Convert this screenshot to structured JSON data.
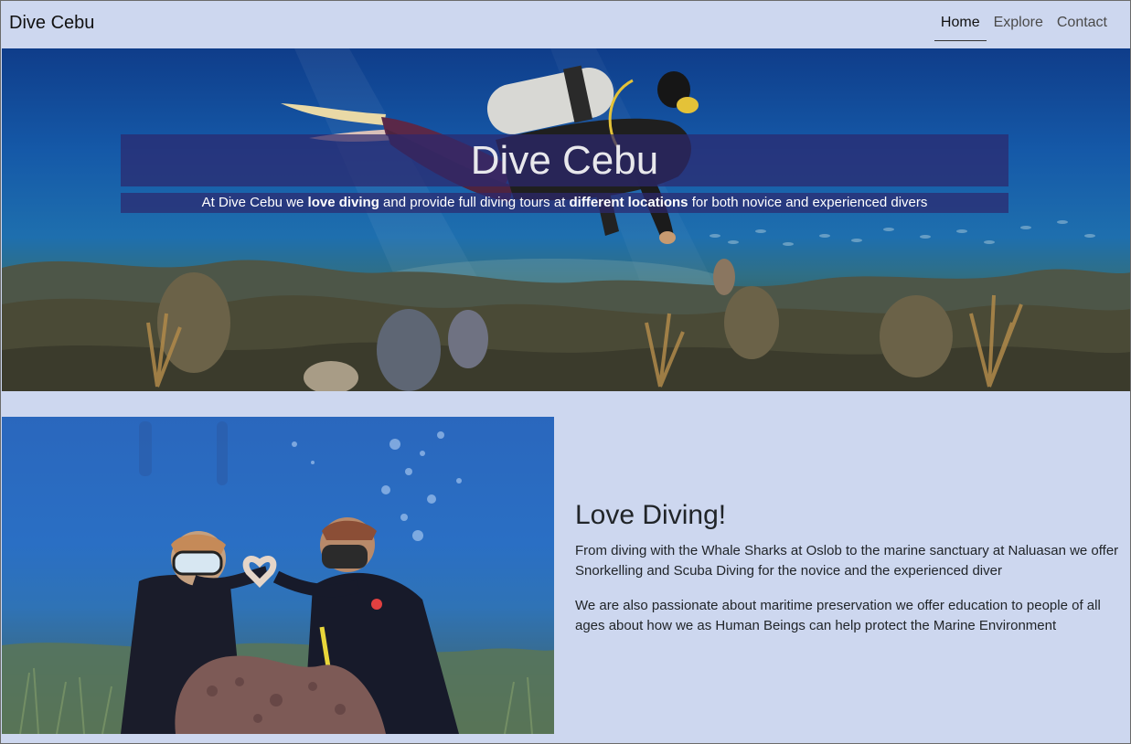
{
  "navbar": {
    "brand": "Dive Cebu",
    "links": [
      {
        "label": "Home",
        "active": true
      },
      {
        "label": "Explore",
        "active": false
      },
      {
        "label": "Contact",
        "active": false
      }
    ]
  },
  "hero": {
    "title": "Dive Cebu",
    "subtitle_parts": {
      "p1": "At Dive Cebu we ",
      "b1": "love diving",
      "p2": " and provide full diving tours at ",
      "b2": "different locations",
      "p3": " for both novice and experienced divers"
    }
  },
  "intro": {
    "heading": "Love Diving!",
    "paragraphs": [
      "From diving with the Whale Sharks at Oslob to the marine sanctuary at Naluasan we offer Snorkelling and Scuba Diving for the novice and the experienced diver",
      "We are also passionate about maritime preservation we offer education to people of all ages about how we as Human Beings can help protect the Marine Environment"
    ]
  },
  "colors": {
    "page_bg": "#cdd7ef",
    "hero_overlay": "#2d286e",
    "text_dark": "#212529"
  }
}
